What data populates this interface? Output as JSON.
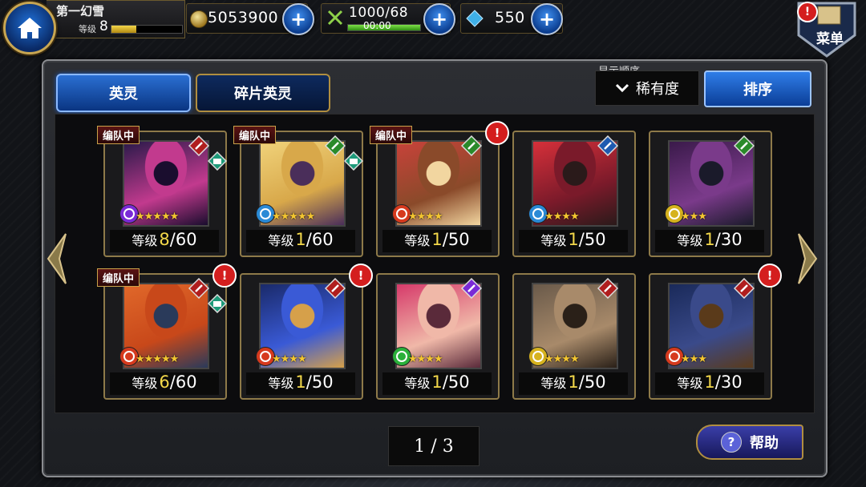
{
  "player": {
    "name": "第一幻雪",
    "level_label": "等级",
    "level": "8",
    "xp_fraction": 0.35
  },
  "resources": {
    "gold": "5053900",
    "stamina": "1000/68",
    "stamina_timer": "00:00",
    "gems": "550"
  },
  "menu": {
    "label": "菜单"
  },
  "tabs": [
    {
      "label": "英灵",
      "active": true
    },
    {
      "label": "碎片英灵",
      "active": false
    }
  ],
  "sort": {
    "caption": "显示顺序",
    "value": "稀有度",
    "button": "排序"
  },
  "cards": [
    {
      "team": "编队中",
      "level_label": "等级",
      "level": "8",
      "max": "/60",
      "class_icon": "dagger-icon",
      "class_color": "#b01e1e",
      "book": true,
      "alert": false,
      "element": "dark",
      "element_color": "#7a2ad6",
      "stars": 5,
      "portrait": [
        "#2a1a4a",
        "#c23a8e",
        "#1a0d2e"
      ]
    },
    {
      "team": "编队中",
      "level_label": "等级",
      "level": "1",
      "max": "/60",
      "class_icon": "claw-icon",
      "class_color": "#2a8a2a",
      "book": true,
      "alert": false,
      "element": "wind",
      "element_color": "#2a8ad6",
      "stars": 5,
      "portrait": [
        "#f0d27a",
        "#d8a84a",
        "#4a2e5a"
      ]
    },
    {
      "team": "编队中",
      "level_label": "等级",
      "level": "1",
      "max": "/50",
      "class_icon": "sword-icon",
      "class_color": "#2a8a2a",
      "book": false,
      "alert": true,
      "element": "fire",
      "element_color": "#d63a1e",
      "stars": 4,
      "portrait": [
        "#c8423a",
        "#8a4a2a",
        "#f2d6a0"
      ]
    },
    {
      "team": "",
      "level_label": "等级",
      "level": "1",
      "max": "/50",
      "class_icon": "spear-icon",
      "class_color": "#1e5ab0",
      "book": false,
      "alert": false,
      "element": "wind",
      "element_color": "#2a8ad6",
      "stars": 4,
      "portrait": [
        "#d6303a",
        "#7a1a2a",
        "#2a1a1a"
      ]
    },
    {
      "team": "",
      "level_label": "等级",
      "level": "1",
      "max": "/30",
      "class_icon": "sword-icon",
      "class_color": "#2a8a2a",
      "book": false,
      "alert": false,
      "element": "light",
      "element_color": "#d6b21e",
      "stars": 3,
      "portrait": [
        "#3a1a4a",
        "#7a3a8a",
        "#1a1a2a"
      ]
    },
    {
      "team": "编队中",
      "level_label": "等级",
      "level": "6",
      "max": "/60",
      "class_icon": "bow-icon",
      "class_color": "#b01e1e",
      "book": true,
      "alert": true,
      "element": "fire",
      "element_color": "#d63a1e",
      "stars": 5,
      "portrait": [
        "#e0682a",
        "#c8481a",
        "#2a3a5a"
      ]
    },
    {
      "team": "",
      "level_label": "等级",
      "level": "1",
      "max": "/50",
      "class_icon": "crossed-swords-icon",
      "class_color": "#b01e1e",
      "book": false,
      "alert": true,
      "element": "fire",
      "element_color": "#d63a1e",
      "stars": 4,
      "portrait": [
        "#1a2a6a",
        "#3a5ad6",
        "#d6a04a"
      ]
    },
    {
      "team": "",
      "level_label": "等级",
      "level": "1",
      "max": "/50",
      "class_icon": "eye-icon",
      "class_color": "#7a2ad6",
      "book": false,
      "alert": false,
      "element": "earth",
      "element_color": "#2ab03a",
      "stars": 4,
      "portrait": [
        "#d63a6a",
        "#f0b8a8",
        "#5a2a3a"
      ]
    },
    {
      "team": "",
      "level_label": "等级",
      "level": "1",
      "max": "/50",
      "class_icon": "sword-icon",
      "class_color": "#b01e1e",
      "book": false,
      "alert": false,
      "element": "light",
      "element_color": "#d6b21e",
      "stars": 4,
      "portrait": [
        "#6a5a4a",
        "#a88a6a",
        "#2a2018"
      ]
    },
    {
      "team": "",
      "level_label": "等级",
      "level": "1",
      "max": "/30",
      "class_icon": "sword-icon",
      "class_color": "#b01e1e",
      "book": false,
      "alert": true,
      "element": "fire",
      "element_color": "#d63a1e",
      "stars": 3,
      "portrait": [
        "#1a2a5a",
        "#3a4a8a",
        "#5a3a1a"
      ]
    }
  ],
  "pager": "1 / 3",
  "help": {
    "label": "帮助"
  }
}
